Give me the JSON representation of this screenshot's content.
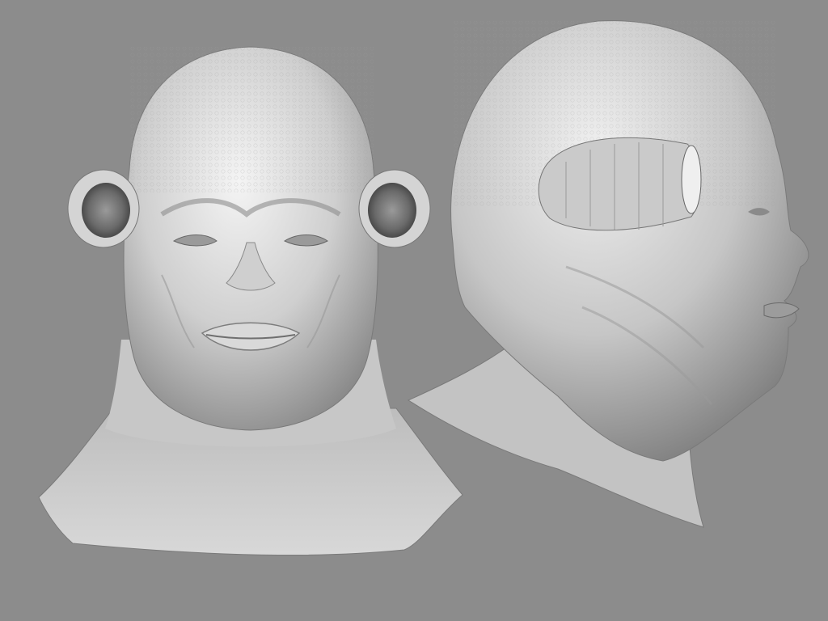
{
  "scene": {
    "background_color": "#8c8c8c",
    "clay_base_color": "#d2d2d2",
    "clay_highlight_color": "#f2f2f2",
    "clay_shadow_color": "#6e6e6e",
    "subjects": [
      {
        "id": "front-view",
        "view": "front",
        "description_tag": "alien-head-sculpt"
      },
      {
        "id": "side-view",
        "view": "profile-right",
        "description_tag": "alien-head-sculpt"
      }
    ]
  }
}
